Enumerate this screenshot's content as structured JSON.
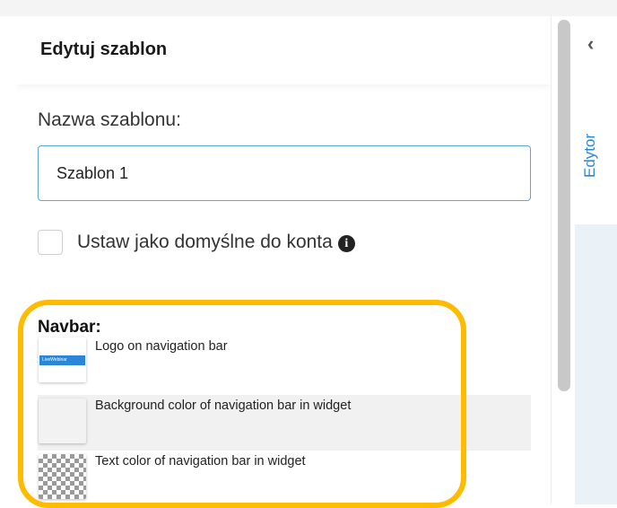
{
  "panel": {
    "title": "Edytuj szablon"
  },
  "form": {
    "name_label": "Nazwa szablonu:",
    "name_value": "Szablon 1",
    "default_label": "Ustaw jako domyślne do konta",
    "default_checked": false,
    "info_icon": "info-icon"
  },
  "navbar": {
    "heading": "Navbar:",
    "options": [
      {
        "label": "Logo on navigation bar",
        "thumb": "logo",
        "logo_text": "LiveWebinar"
      },
      {
        "label": "Background color of navigation bar in widget",
        "thumb": "color",
        "color": "#f2f2f2"
      },
      {
        "label": "Text color of navigation bar in widget",
        "thumb": "transparent"
      }
    ]
  },
  "sidebar": {
    "tab_label": "Edytor",
    "collapse_icon": "chevron-left-icon"
  },
  "colors": {
    "accent": "#2b86d6",
    "input_border": "#5aa9dc",
    "highlight": "#ffbb00"
  }
}
